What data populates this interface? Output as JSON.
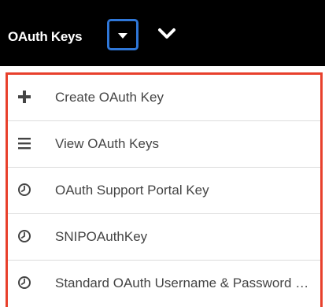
{
  "header": {
    "tab_label": "OAuth Keys"
  },
  "menu": {
    "items": [
      {
        "label": "Create OAuth Key",
        "icon": "plus-icon"
      },
      {
        "label": "View OAuth Keys",
        "icon": "list-icon"
      },
      {
        "label": "OAuth Support Portal Key",
        "icon": "clock-icon"
      },
      {
        "label": "SNIPOAuthKey",
        "icon": "clock-icon"
      },
      {
        "label": "Standard OAuth Username & Password Key",
        "icon": "clock-icon"
      }
    ]
  },
  "colors": {
    "topbar": "#000000",
    "focus_border": "#2f77d8",
    "highlight_border": "#e8402c",
    "text": "#444444"
  }
}
